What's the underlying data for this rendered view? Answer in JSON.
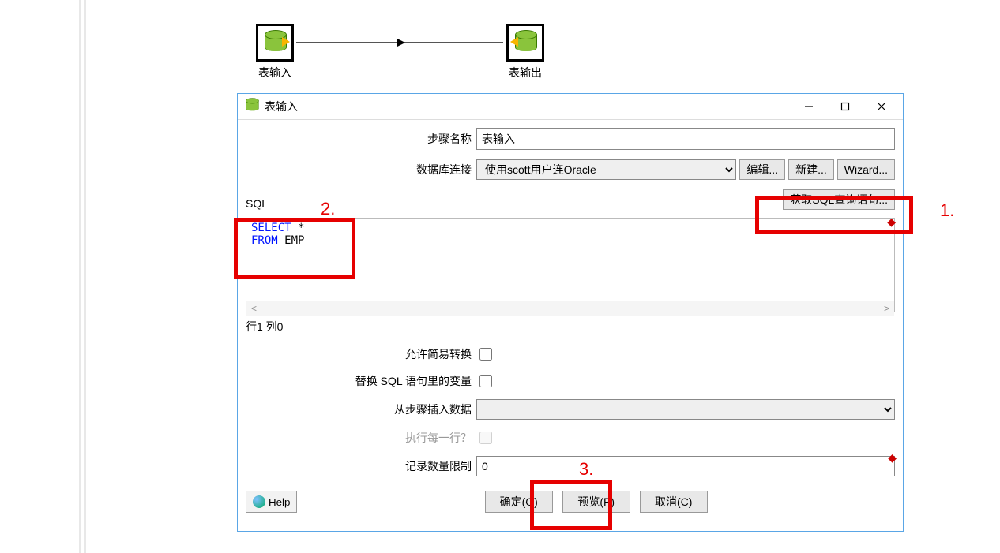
{
  "canvas": {
    "node_in_label": "表输入",
    "node_out_label": "表输出"
  },
  "dialog": {
    "title": "表输入",
    "labels": {
      "step_name": "步骤名称",
      "db_conn": "数据库连接",
      "sql": "SQL",
      "allow_lazy": "允许简易转换",
      "replace_vars": "替换 SQL 语句里的变量",
      "insert_from_step": "从步骤插入数据",
      "exec_each_row": "执行每一行？",
      "limit": "记录数量限制"
    },
    "values": {
      "step_name": "表输入",
      "db_conn": "使用scott用户连Oracle",
      "sql_kw1": "SELECT",
      "sql_rest1": " *",
      "sql_kw2": "FROM",
      "sql_rest2": " EMP",
      "limit": "0"
    },
    "buttons": {
      "edit": "编辑...",
      "new": "新建...",
      "wizard": "Wizard...",
      "get_sql": "获取SQL查询语句...",
      "help": "Help",
      "ok": "确定(O)",
      "preview": "预览(P)",
      "cancel": "取消(C)"
    },
    "status": "行1 列0"
  },
  "annotations": {
    "n1": "1.",
    "n2": "2.",
    "n3": "3."
  }
}
